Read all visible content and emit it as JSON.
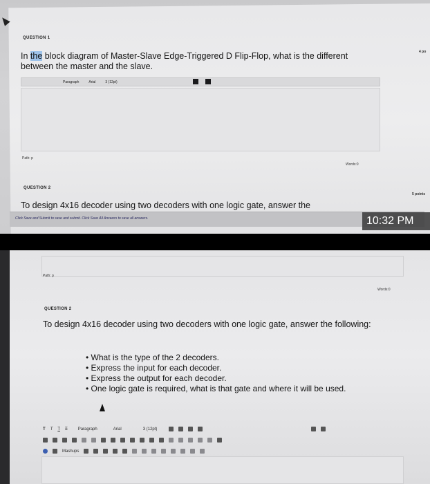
{
  "top": {
    "q1_label": "QUESTION 1",
    "q1_points": "4 po",
    "q1_text_pre": "In ",
    "q1_text_highlight": "the",
    "q1_text_post": " block diagram of Master-Slave Edge-Triggered D Flip-Flop, what is the different between the master and the slave.",
    "editor_toolbar": {
      "paragraph": "Paragraph",
      "font": "Arial",
      "size": "3 (12pt)"
    },
    "path_label": "Path: p",
    "words_label": "Words:0",
    "q2_label": "QUESTION 2",
    "q2_points": "5 points",
    "q2_text": "To design 4x16 decoder using two decoders with one logic gate, answer the",
    "save_text": "Click Save and Submit to save and submit. Click Save All Answers to save all answers.",
    "time": "10:32 PM"
  },
  "bottom": {
    "path_label": "Path: p",
    "words_label": "Words:0",
    "q2_label": "QUESTION 2",
    "q2_text": "To design 4x16 decoder using two decoders with one logic gate, answer the following:",
    "bullets": [
      "What is the type of the 2 decoders.",
      "Express the input for each decoder.",
      "Express the output for each decoder.",
      "One logic gate is required, what is that gate and where it will be used."
    ],
    "editor_toolbar": {
      "row1": [
        "T",
        "T",
        "T",
        "T",
        "Paragraph",
        "Arial",
        "3 (12pt)"
      ],
      "row3_label": "Mashups"
    }
  }
}
